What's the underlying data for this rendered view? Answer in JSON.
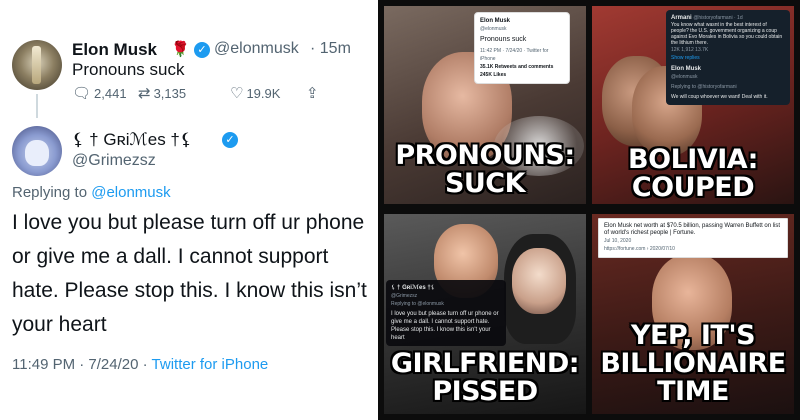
{
  "tweet": {
    "name": "Elon Musk",
    "rose_emoji": "🌹",
    "handle": "@elonmusk",
    "time": "· 15m",
    "text": "Pronouns suck",
    "reply_count": "2,441",
    "retweet_count": "3,135",
    "like_count": "19.9K",
    "icons": {
      "reply": "speech-bubble-icon",
      "retweet": "retweet-icon",
      "like": "heart-icon",
      "share": "share-icon"
    }
  },
  "reply": {
    "name": "⚸ † Gʀiℳes †⚸",
    "handle": "@Grimezsz",
    "replying_label": "Replying to",
    "replying_to": "@elonmusk",
    "text": "I love you but please turn off ur phone or give me a dall.  I cannot support hate.  Please stop this. I know this isn’t your heart",
    "timestamp": "11:49 PM · 7/24/20 · ",
    "source": "Twitter for iPhone"
  },
  "memes": [
    {
      "caption_line1": "PRONOUNS:",
      "caption_line2": "SUCK",
      "card": {
        "name": "Elon Musk",
        "handle": "@elonmusk",
        "text": "Pronouns suck",
        "meta": "11:42 PM · 7/24/20 · Twitter for iPhone",
        "stats": "35.1K Retweets and comments  245K Likes"
      }
    },
    {
      "caption_line1": "BOLIVIA:",
      "caption_line2": "COUPED",
      "card": {
        "name": "Armani",
        "handle": "@historyofarmani · 1d",
        "text": "You know what wasnt in the best interest of people? the U.S. government organizing a coup against Evo Morales in Bolivia so you could obtain the lithium there.",
        "stats": "12K   1,912   13.7K",
        "show_replies": "Show replies",
        "reply_name": "Elon Musk",
        "reply_handle": "@elonmusk",
        "reply_to": "Replying to @historyofarmani",
        "reply_text": "We will coup whoever we want! Deal with it."
      }
    },
    {
      "caption_line1": "GIRLFRIEND:",
      "caption_line2": "PISSED",
      "card": {
        "name": "⚸ † Gʀiℳes †⚸",
        "handle": "@Grimezsz",
        "reply_to": "Replying to @elonmusk",
        "text": "I love you but please turn off ur phone or give me a dall. I cannot support hate. Please stop this. I know this isn't your heart"
      }
    },
    {
      "caption_line1": "YEP, IT'S",
      "caption_line2": "BILLIONAIRE",
      "caption_line3": "TIME",
      "card": {
        "headline": "Elon Musk net worth at $70.5 billion, passing Warren Buffett on list of world's richest people | Fortune.",
        "date": "Jul 10, 2020",
        "url": "https://fortune.com › 2020/07/10"
      }
    }
  ]
}
